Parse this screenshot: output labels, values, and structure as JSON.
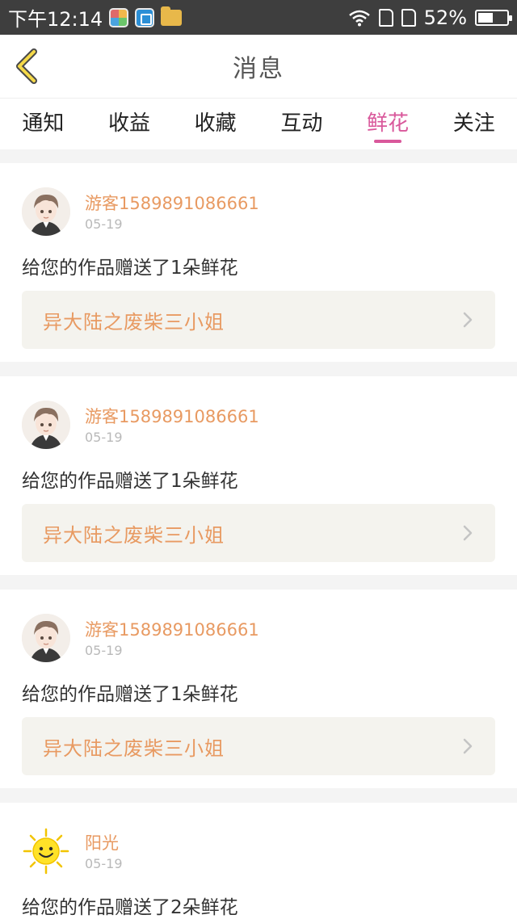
{
  "status_bar": {
    "time": "下午12:14",
    "battery": "52%",
    "battery_level": 0.52
  },
  "header": {
    "title": "消息"
  },
  "tabs": [
    {
      "label": "通知"
    },
    {
      "label": "收益"
    },
    {
      "label": "收藏"
    },
    {
      "label": "互动"
    },
    {
      "label": "鲜花"
    },
    {
      "label": "关注"
    }
  ],
  "active_tab_index": 4,
  "colors": {
    "accent": "#d9589b",
    "username": "#e89a62",
    "work_link_bg": "#f4f3ee"
  },
  "feed": [
    {
      "username": "游客1589891086661",
      "date": "05-19",
      "message": "给您的作品赠送了1朵鲜花",
      "work_title": "异大陆之废柴三小姐",
      "avatar": "anime-boy-avatar"
    },
    {
      "username": "游客1589891086661",
      "date": "05-19",
      "message": "给您的作品赠送了1朵鲜花",
      "work_title": "异大陆之废柴三小姐",
      "avatar": "anime-boy-avatar"
    },
    {
      "username": "游客1589891086661",
      "date": "05-19",
      "message": "给您的作品赠送了1朵鲜花",
      "work_title": "异大陆之废柴三小姐",
      "avatar": "anime-boy-avatar"
    },
    {
      "username": "阳光",
      "date": "05-19",
      "message": "给您的作品赠送了2朵鲜花",
      "avatar": "sun-avatar"
    }
  ]
}
